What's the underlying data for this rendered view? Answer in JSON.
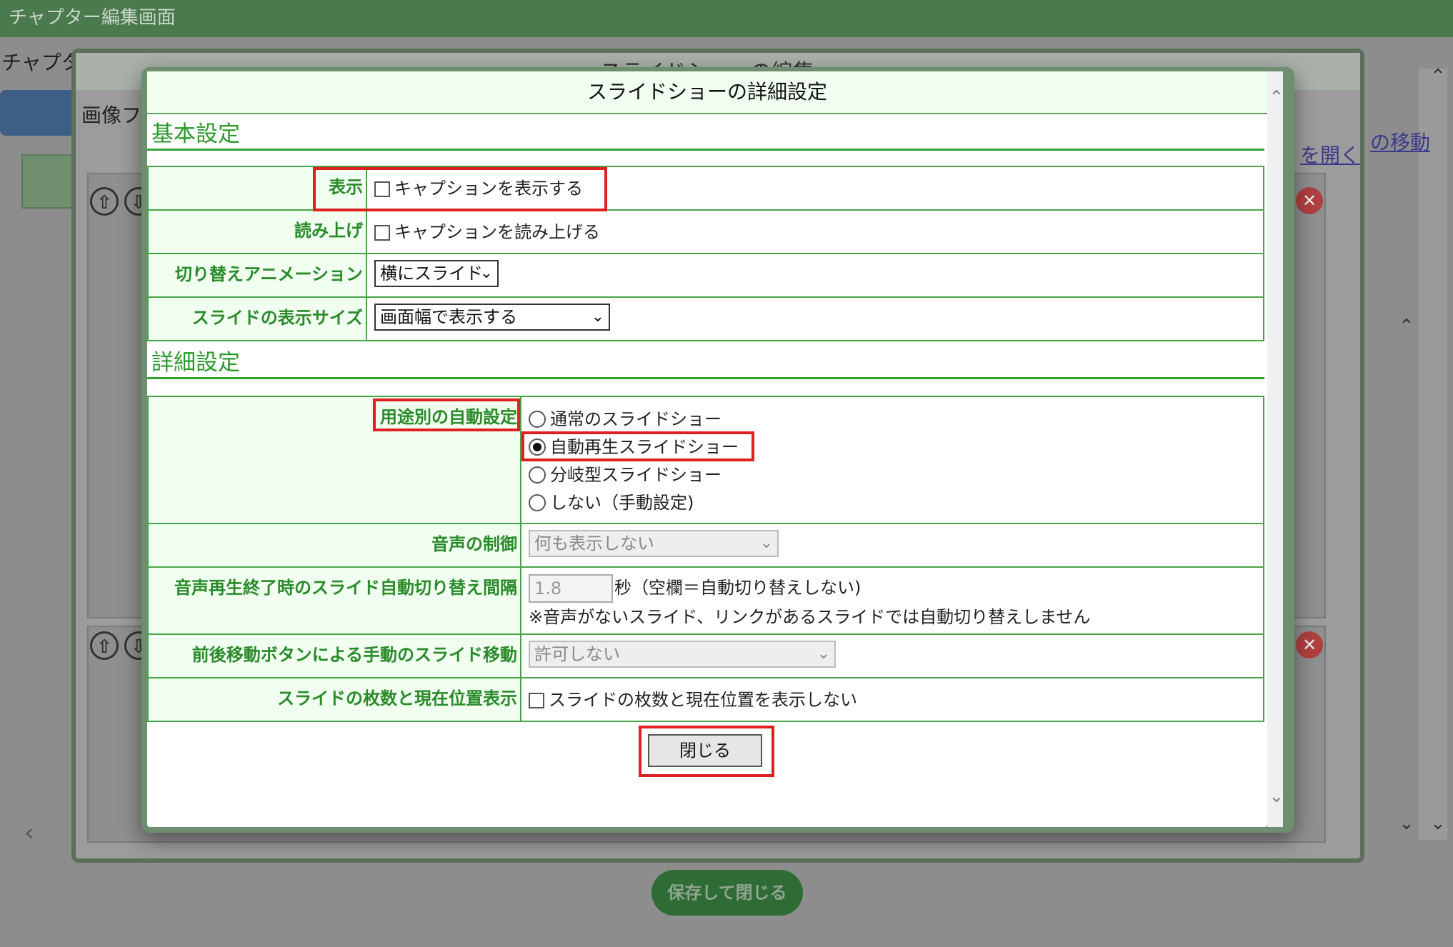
{
  "app": {
    "title": "チャプター編集画面",
    "chapter_label": "チャプタ",
    "save_close_label": "保存して閉じる"
  },
  "middle_dialog": {
    "title": "スライドショーの編集",
    "sub_label": "画像フ",
    "link_open": "を開く",
    "link_move": "の移動"
  },
  "modal": {
    "title": "スライドショーの詳細設定",
    "basic_section": "基本設定",
    "detail_section": "詳細設定",
    "rows": {
      "display": {
        "label": "表示",
        "checkbox_label": "キャプションを表示する",
        "checked": false
      },
      "read_aloud": {
        "label": "読み上げ",
        "checkbox_label": "キャプションを読み上げる",
        "checked": false
      },
      "animation": {
        "label": "切り替えアニメーション",
        "value": "横にスライド"
      },
      "slide_size": {
        "label": "スライドの表示サイズ",
        "value": "画面幅で表示する"
      },
      "auto_setting": {
        "label": "用途別の自動設定",
        "options": [
          "通常のスライドショー",
          "自動再生スライドショー",
          "分岐型スライドショー",
          "しない（手動設定)"
        ],
        "selected_index": 1
      },
      "audio_control": {
        "label": "音声の制御",
        "value": "何も表示しない"
      },
      "auto_interval": {
        "label": "音声再生終了時のスライド自動切り替え間隔",
        "value": "1.8",
        "unit_text": "秒（空欄＝自動切り替えしない)",
        "note": "※音声がないスライド、リンクがあるスライドでは自動切り替えしません"
      },
      "manual_move": {
        "label": "前後移動ボタンによる手動のスライド移動",
        "value": "許可しない"
      },
      "slide_count": {
        "label": "スライドの枚数と現在位置表示",
        "checkbox_label": "スライドの枚数と現在位置を表示しない",
        "checked": false
      }
    },
    "close_label": "閉じる"
  },
  "icons": {
    "arrow_up": "⇧",
    "arrow_down": "⇩",
    "close_x": "✕",
    "chevron_down": "⌄",
    "chevron_up": "⌃",
    "chevron_left": "‹"
  }
}
